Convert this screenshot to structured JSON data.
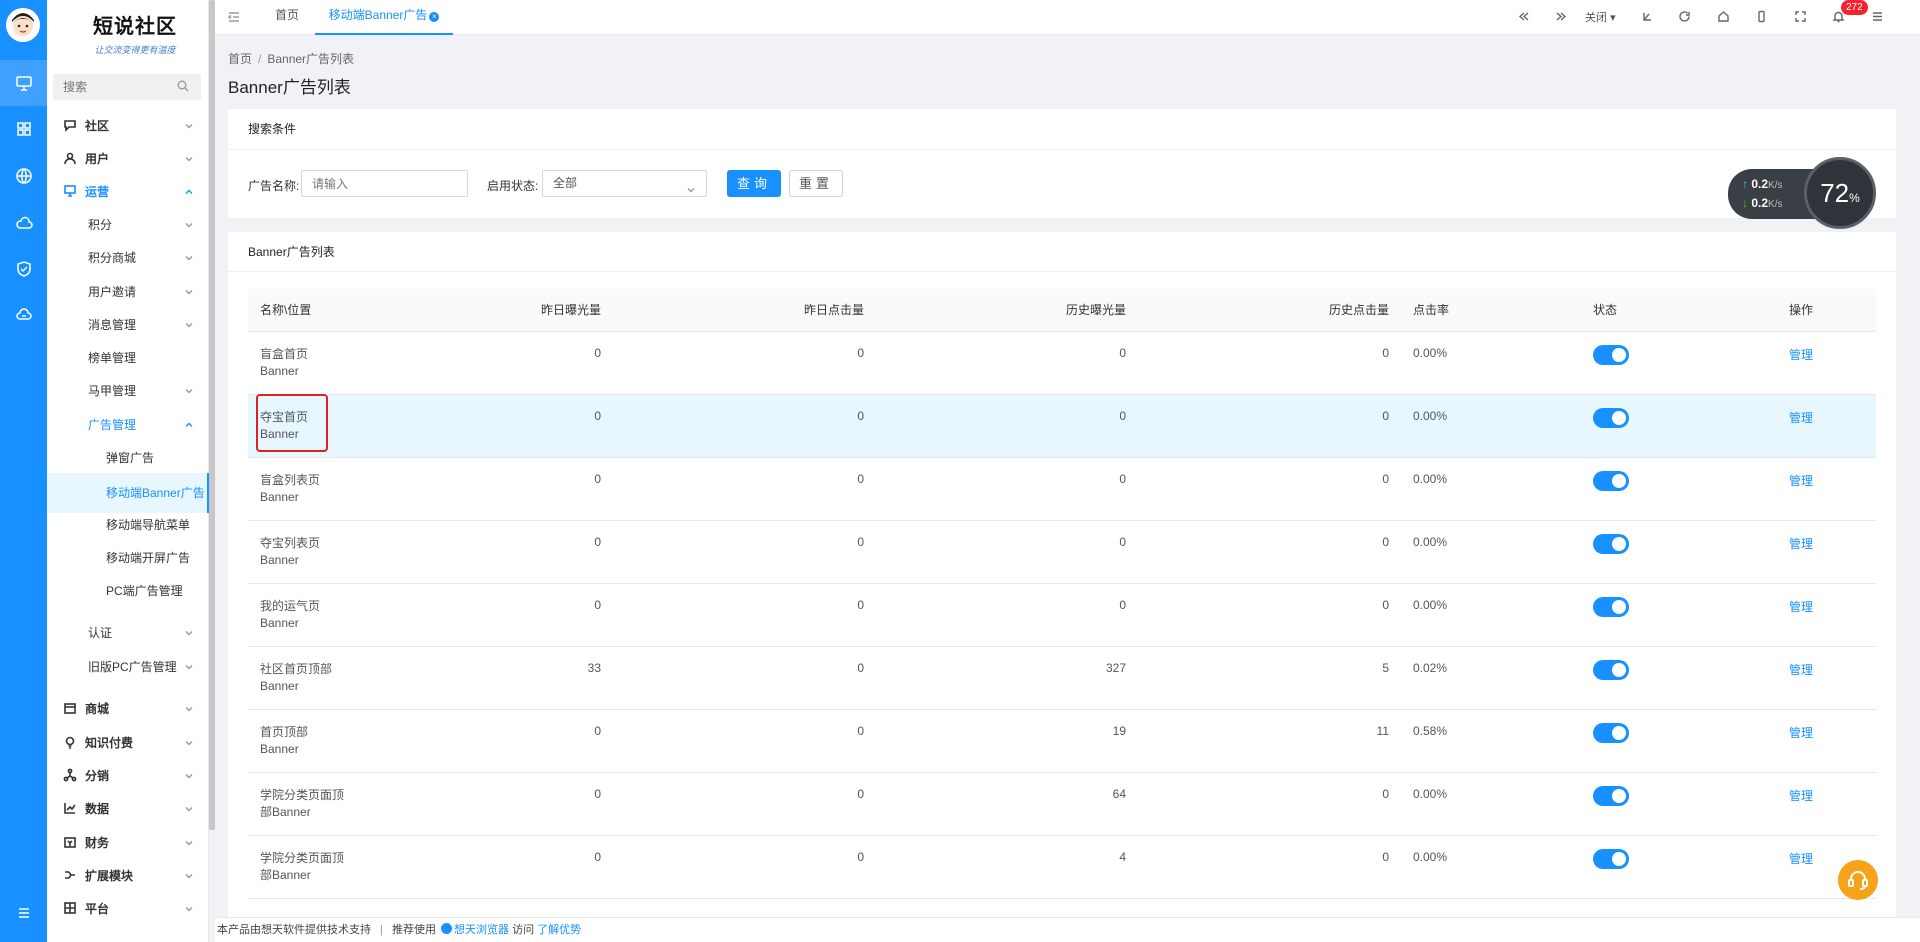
{
  "brand": {
    "name": "短说社区",
    "slogan": "让交流变得更有温度"
  },
  "colors": {
    "primary": "#1890ff",
    "highlight_box": "#e0201f"
  },
  "sidebar": {
    "search_placeholder": "搜索",
    "items": [
      {
        "label": "社区",
        "icon": "chat-icon"
      },
      {
        "label": "用户",
        "icon": "user-icon"
      },
      {
        "label": "运营",
        "icon": "monitor-icon"
      },
      {
        "label": "积分"
      },
      {
        "label": "积分商城"
      },
      {
        "label": "用户邀请"
      },
      {
        "label": "消息管理"
      },
      {
        "label": "榜单管理"
      },
      {
        "label": "马甲管理"
      },
      {
        "label": "广告管理"
      },
      {
        "label": "弹窗广告"
      },
      {
        "label": "移动端Banner广告"
      },
      {
        "label": "移动端导航菜单"
      },
      {
        "label": "移动端开屏广告"
      },
      {
        "label": "PC端广告管理"
      },
      {
        "label": "认证"
      },
      {
        "label": "旧版PC广告管理"
      },
      {
        "label": "商城",
        "icon": "shop-icon"
      },
      {
        "label": "知识付费",
        "icon": "bulb-icon"
      },
      {
        "label": "分销",
        "icon": "share-icon"
      },
      {
        "label": "数据",
        "icon": "chart-icon"
      },
      {
        "label": "财务",
        "icon": "wallet-icon"
      },
      {
        "label": "扩展模块",
        "icon": "module-icon"
      },
      {
        "label": "平台",
        "icon": "grid-icon"
      }
    ]
  },
  "topbar": {
    "tabs": [
      {
        "label": "首页"
      },
      {
        "label": "移动端Banner广告"
      }
    ],
    "close_label": "关闭",
    "notification_count": "272"
  },
  "breadcrumb": {
    "home": "首页",
    "current": "Banner广告列表"
  },
  "page_title": "Banner广告列表",
  "search_panel": {
    "title": "搜索条件",
    "name_label": "广告名称:",
    "name_placeholder": "请输入",
    "status_label": "启用状态:",
    "status_value": "全部",
    "query_button": "查询",
    "reset_button": "重置"
  },
  "table_panel": {
    "title": "Banner广告列表",
    "columns": [
      "名称\\位置",
      "昨日曝光量",
      "昨日点击量",
      "历史曝光量",
      "历史点击量",
      "点击率",
      "状态",
      "操作"
    ],
    "rows": [
      {
        "name1": "盲盒首页",
        "name2": "Banner",
        "y_exp": "0",
        "y_click": "0",
        "h_exp": "0",
        "h_click": "0",
        "ctr": "0.00%",
        "action": "管理"
      },
      {
        "name1": "夺宝首页",
        "name2": "Banner",
        "y_exp": "0",
        "y_click": "0",
        "h_exp": "0",
        "h_click": "0",
        "ctr": "0.00%",
        "action": "管理"
      },
      {
        "name1": "盲盒列表页",
        "name2": "Banner",
        "y_exp": "0",
        "y_click": "0",
        "h_exp": "0",
        "h_click": "0",
        "ctr": "0.00%",
        "action": "管理"
      },
      {
        "name1": "夺宝列表页",
        "name2": "Banner",
        "y_exp": "0",
        "y_click": "0",
        "h_exp": "0",
        "h_click": "0",
        "ctr": "0.00%",
        "action": "管理"
      },
      {
        "name1": "我的运气页",
        "name2": "Banner",
        "y_exp": "0",
        "y_click": "0",
        "h_exp": "0",
        "h_click": "0",
        "ctr": "0.00%",
        "action": "管理"
      },
      {
        "name1": "社区首页顶部",
        "name2": "Banner",
        "y_exp": "33",
        "y_click": "0",
        "h_exp": "327",
        "h_click": "5",
        "ctr": "0.02%",
        "action": "管理"
      },
      {
        "name1": "首页顶部",
        "name2": "Banner",
        "y_exp": "0",
        "y_click": "0",
        "h_exp": "19",
        "h_click": "11",
        "ctr": "0.58%",
        "action": "管理"
      },
      {
        "name1": "学院分类页面顶",
        "name2": "部Banner",
        "y_exp": "0",
        "y_click": "0",
        "h_exp": "64",
        "h_click": "0",
        "ctr": "0.00%",
        "action": "管理"
      },
      {
        "name1": "学院分类页面顶",
        "name2": "部Banner",
        "y_exp": "0",
        "y_click": "0",
        "h_exp": "4",
        "h_click": "0",
        "ctr": "0.00%",
        "action": "管理"
      }
    ]
  },
  "net_widget": {
    "up": "0.2",
    "down": "0.2",
    "unit": "K/s",
    "percent": "72",
    "percent_sign": "%"
  },
  "footer": {
    "support": "本产品由想天软件提供技术支持",
    "divider": "|",
    "recommend": "推荐使用",
    "browser": "想天浏览器",
    "visit": "访问",
    "learn": "了解优势"
  }
}
